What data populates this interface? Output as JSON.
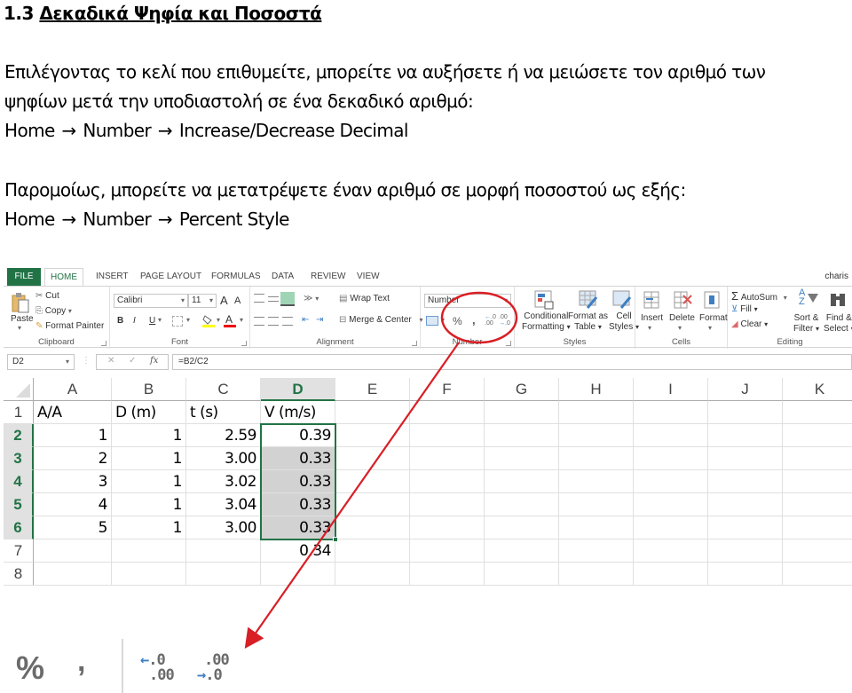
{
  "heading": {
    "number": "1.3",
    "title": "Δεκαδικά Ψηφία και Ποσοστά"
  },
  "paragraph1": {
    "line1": "Επιλέγοντας το κελί που επιθυμείτε, μπορείτε να αυξήσετε ή να μειώσετε τον αριθμό των",
    "line2": "ψηφίων μετά την υποδιαστολή σε ένα δεκαδικό αριθμό:",
    "path": [
      "Home",
      "Number",
      "Increase/Decrease Decimal"
    ]
  },
  "paragraph2": {
    "line1": "Παρομοίως, μπορείτε να μετατρέψετε έναν αριθμό σε μορφή ποσοστού ως εξής:",
    "path": [
      "Home",
      "Number",
      "Percent Style"
    ]
  },
  "path_arrow": "→",
  "excel": {
    "tabs": [
      "FILE",
      "HOME",
      "INSERT",
      "PAGE LAYOUT",
      "FORMULAS",
      "DATA",
      "REVIEW",
      "VIEW"
    ],
    "active_tab": "HOME",
    "user": "charis",
    "clipboard": {
      "paste": "Paste",
      "cut": "Cut",
      "copy": "Copy",
      "format_painter": "Format Painter",
      "label": "Clipboard"
    },
    "font": {
      "name": "Calibri",
      "size": "11",
      "bold": "B",
      "italic": "I",
      "underline": "U",
      "grow": "A",
      "shrink": "A",
      "font_color": "A",
      "label": "Font"
    },
    "alignment": {
      "wrap_text": "Wrap Text",
      "merge_center": "Merge & Center",
      "label": "Alignment"
    },
    "number": {
      "format": "Number",
      "percent": "%",
      "comma": ",",
      "increase": "←.0 .00",
      "decrease": ".00 →.0",
      "label": "Number"
    },
    "styles": {
      "conditional": [
        "Conditional",
        "Formatting"
      ],
      "format_table": [
        "Format as",
        "Table"
      ],
      "cell_styles": [
        "Cell",
        "Styles"
      ],
      "label": "Styles"
    },
    "cells": {
      "insert": "Insert",
      "delete": "Delete",
      "format": "Format",
      "label": "Cells"
    },
    "editing": {
      "autosum": "AutoSum",
      "fill": "Fill",
      "clear": "Clear",
      "sort": [
        "Sort &",
        "Filter"
      ],
      "find": [
        "Find &",
        "Select"
      ],
      "label": "Editing"
    },
    "name_box": "D2",
    "formula": "=B2/C2",
    "fx": "fx",
    "columns": [
      "A",
      "B",
      "C",
      "D",
      "E",
      "F",
      "G",
      "H",
      "I",
      "J",
      "K"
    ],
    "selected_column": "D",
    "rows": [
      "1",
      "2",
      "3",
      "4",
      "5",
      "6",
      "7",
      "8"
    ],
    "header_row": [
      "A/A",
      "D (m)",
      "t (s)",
      "V (m/s)"
    ],
    "data_rows": [
      [
        "1",
        "1",
        "2.59",
        "0.39"
      ],
      [
        "2",
        "1",
        "3.00",
        "0.33"
      ],
      [
        "3",
        "1",
        "3.02",
        "0.33"
      ],
      [
        "4",
        "1",
        "3.04",
        "0.33"
      ],
      [
        "5",
        "1",
        "3.00",
        "0.33"
      ]
    ],
    "row7_d": "0.34"
  },
  "zoomed_icons": {
    "percent": "%",
    "comma": ",",
    "increase_top": ".0",
    "increase_bottom": ".00",
    "decrease_top": ".00",
    "decrease_bottom": ".0",
    "arrow_left": "←",
    "arrow_right": "→"
  },
  "annotation_color": "#d81f26",
  "excel_green": "#217346"
}
